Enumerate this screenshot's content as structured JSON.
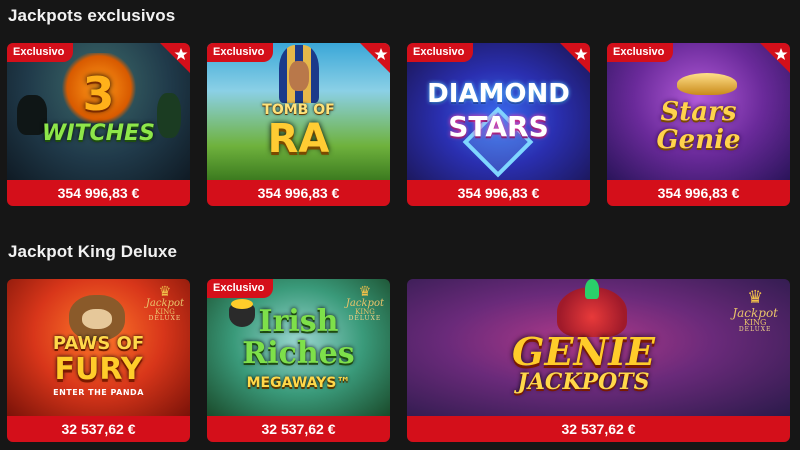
{
  "sections": [
    {
      "title": "Jackpots exclusivos"
    },
    {
      "title": "Jackpot King Deluxe"
    }
  ],
  "exclusive_games": [
    {
      "title_line1": "3",
      "title_line2": "WITCHES",
      "badge": "Exclusivo",
      "price": "354 996,83 €"
    },
    {
      "title_line1": "TOMB OF",
      "title_line2": "RA",
      "badge": "Exclusivo",
      "price": "354 996,83 €"
    },
    {
      "title_line1": "DIAMOND",
      "title_line2": "STARS",
      "badge": "Exclusivo",
      "price": "354 996,83 €"
    },
    {
      "title_line1": "Stars",
      "title_line2": "Genie",
      "badge": "Exclusivo",
      "price": "354 996,83 €"
    }
  ],
  "deluxe_games": [
    {
      "title_line1": "PAWS OF",
      "title_line2": "FURY",
      "subtitle": "ENTER THE PANDA",
      "price": "32 537,62 €"
    },
    {
      "title_line1": "Irish",
      "title_line2": "Riches",
      "subtitle": "MEGAWAYS™",
      "badge": "Exclusivo",
      "price": "32 537,62 €"
    },
    {
      "title_line1": "GENIE",
      "title_line2": "JACKPOTS",
      "price": "32 537,62 €"
    }
  ],
  "emblem": {
    "name": "Jackpot",
    "sub": "KING",
    "tag": "DELUXE"
  },
  "colors": {
    "background": "#161616",
    "accent": "#d40f1a",
    "text": "#ffffff"
  },
  "icons": {
    "corner": "pokerstars-star-icon",
    "emblem": "crown-icon"
  }
}
